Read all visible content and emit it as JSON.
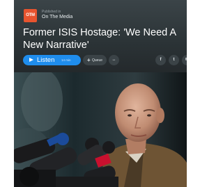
{
  "publisher": {
    "logo_text": "OTM",
    "small_label": "Published in",
    "name": "On The Media"
  },
  "episode": {
    "title": "Former ISIS Hostage: 'We Need A New Narrative'"
  },
  "actions": {
    "listen_label": "Listen",
    "listen_duration": "14 min",
    "queue_label": "Queue",
    "share_symbol": "↔"
  },
  "social": {
    "facebook": "f",
    "twitter": "t",
    "email": "✉"
  },
  "colors": {
    "accent": "#1f8ded",
    "header_bg": "#2b3336",
    "logo": "#e8542f"
  }
}
